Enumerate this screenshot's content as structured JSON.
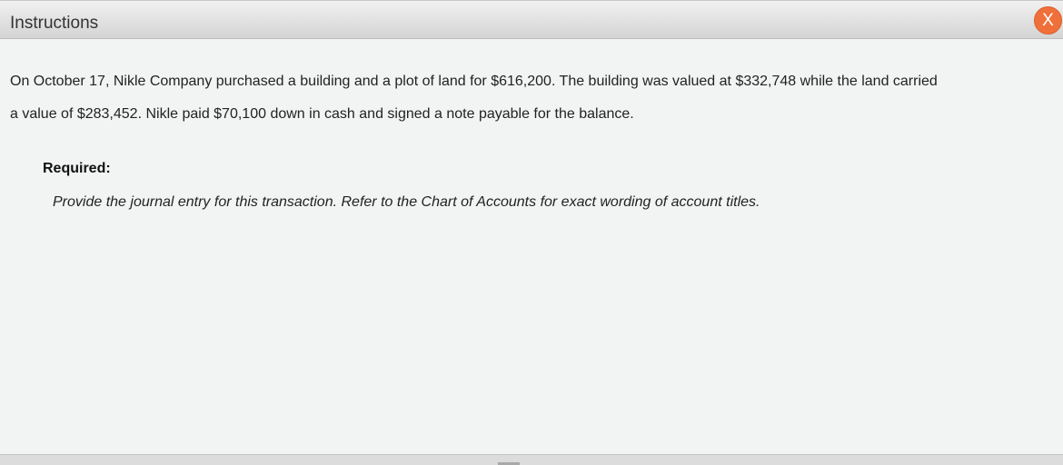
{
  "window": {
    "title": "Instructions",
    "close_label": "X"
  },
  "instructions": {
    "paragraph_line1": "On October 17, Nikle Company purchased a building and a plot of land for $616,200. The building was valued at $332,748 while the land carried",
    "paragraph_line2": "a value of $283,452. Nikle paid $70,100 down in cash and signed a note payable for the balance.",
    "required_heading": "Required:",
    "required_text": "Provide the journal entry for this transaction. Refer to the Chart of Accounts for exact wording of account titles."
  },
  "colors": {
    "close_button": "#f0703b",
    "background": "#f2f4f3"
  }
}
